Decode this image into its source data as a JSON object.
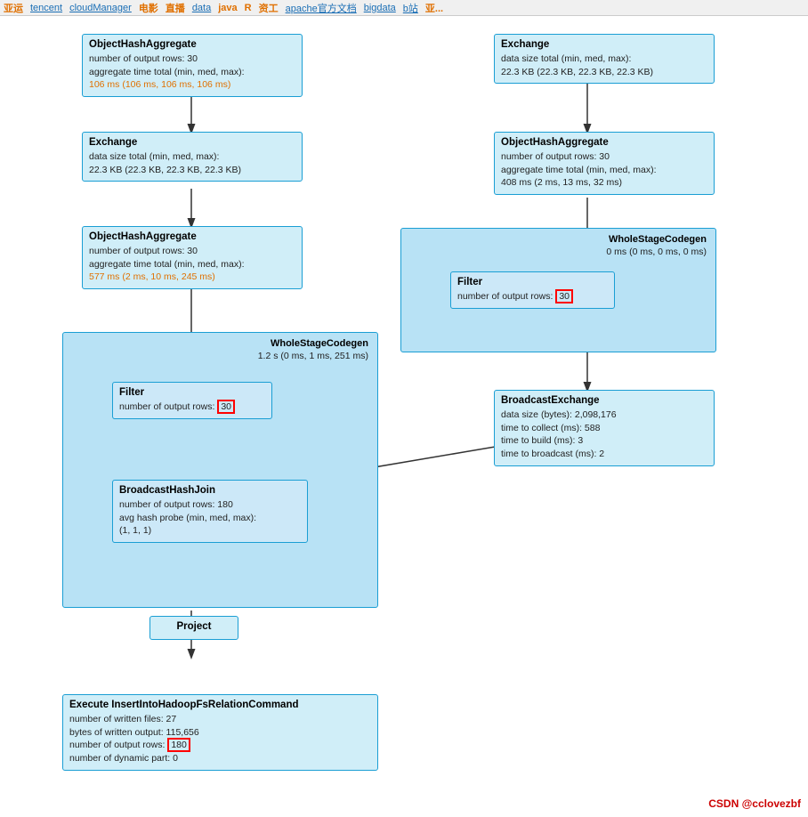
{
  "topbar": {
    "items": [
      "亚运",
      "tencent",
      "cloudManager",
      "电影",
      "直播",
      "data",
      "java",
      "R",
      "资工",
      "apache官方文档",
      "bigdata",
      "b站",
      "亚..."
    ]
  },
  "nodes": {
    "left_col": {
      "node1": {
        "title": "ObjectHashAggregate",
        "info_line1": "number of output rows: 30",
        "info_line2": "aggregate time total (min, med, max):",
        "info_line3_highlight": "106 ms (106 ms, 106 ms, 106 ms)"
      },
      "node2": {
        "title": "Exchange",
        "info_line1": "data size total (min, med, max):",
        "info_line2": "22.3 KB (22.3 KB, 22.3 KB, 22.3 KB)"
      },
      "node3": {
        "title": "ObjectHashAggregate",
        "info_line1": "number of output rows: 30",
        "info_line2": "aggregate time total (min, med, max):",
        "info_line3_highlight": "577 ms (2 ms, 10 ms, 245 ms)"
      },
      "wsc_left": {
        "title": "WholeStageCodegen",
        "subtitle": "1.2 s (0 ms, 1 ms, 251 ms)"
      },
      "filter_left": {
        "title": "Filter",
        "info": "number of output rows: ",
        "value": "30"
      },
      "bcast_join": {
        "title": "BroadcastHashJoin",
        "info_line1": "number of output rows: 180",
        "info_line2": "avg hash probe (min, med, max):",
        "info_line3": "(1, 1, 1)"
      },
      "project": {
        "title": "Project"
      },
      "execute": {
        "title": "Execute InsertIntoHadoopFsRelationCommand",
        "info_line1": "number of written files: 27",
        "info_line2": "bytes of written output: 115,656",
        "info_line3": "number of output rows: ",
        "value": "180",
        "info_line4": "number of dynamic part: 0"
      }
    },
    "right_col": {
      "exchange": {
        "title": "Exchange",
        "info_line1": "data size total (min, med, max):",
        "info_line2": "22.3 KB (22.3 KB, 22.3 KB, 22.3 KB)"
      },
      "obj_hash_agg": {
        "title": "ObjectHashAggregate",
        "info_line1": "number of output rows: 30",
        "info_line2": "aggregate time total (min, med, max):",
        "info_line3": "408 ms (2 ms, 13 ms, 32 ms)"
      },
      "wsc_right": {
        "title": "WholeStageCodegen",
        "subtitle": "0 ms (0 ms, 0 ms, 0 ms)"
      },
      "filter_right": {
        "title": "Filter",
        "info": "number of output rows: ",
        "value": "30"
      },
      "bcast_exchange": {
        "title": "BroadcastExchange",
        "info_line1": "data size (bytes): 2,098,176",
        "info_line2": "time to collect (ms): 588",
        "info_line3": "time to build (ms): 3",
        "info_line4": "time to broadcast (ms): 2"
      }
    }
  },
  "watermark": "CSDN @cclovezbf"
}
